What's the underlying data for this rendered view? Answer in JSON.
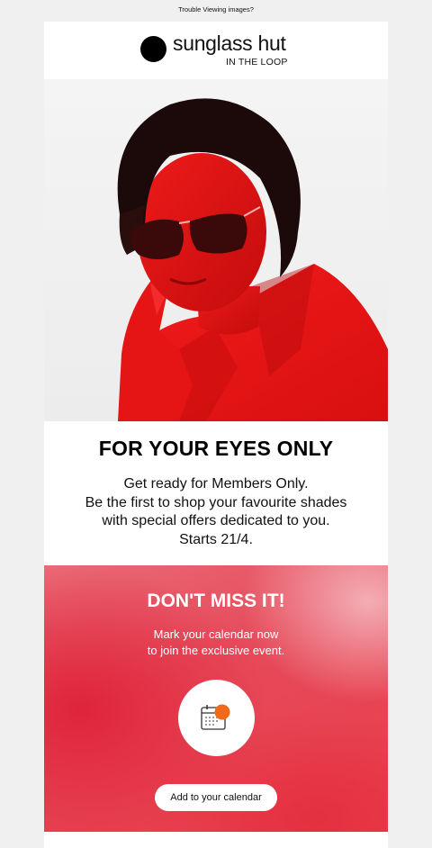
{
  "topbar": {
    "trouble_text": "Trouble Viewing images?"
  },
  "header": {
    "brand_name": "sunglass hut",
    "brand_tagline": "IN THE LOOP"
  },
  "intro": {
    "title": "FOR YOUR EYES ONLY",
    "lines": [
      "Get ready for Members Only.",
      "Be the first to shop your favourite shades",
      "with special offers dedicated to you.",
      "Starts 21/4."
    ]
  },
  "cta": {
    "title": "DON'T MISS IT!",
    "lines": [
      "Mark your calendar now",
      "to join the exclusive event."
    ],
    "button_label": "Add to your calendar",
    "icon": "calendar-icon"
  },
  "colors": {
    "brand_red": "#e8303f",
    "accent_orange": "#f06a1a",
    "text_dark": "#111111"
  }
}
